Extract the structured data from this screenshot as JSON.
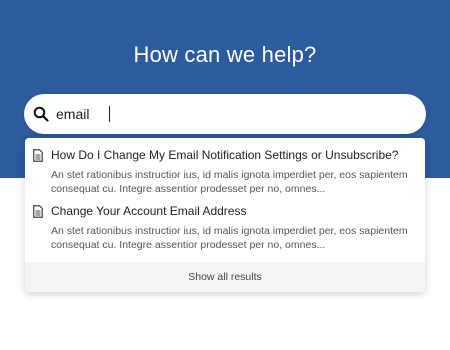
{
  "hero": {
    "title": "How can we help?"
  },
  "search": {
    "value": "email",
    "placeholder": ""
  },
  "results": [
    {
      "title": "How Do I Change My Email Notification Settings or Unsubscribe?",
      "snippet": "An stet rationibus instructior ius, id malis ignota imperdiet per, eos sapientem consequat cu. Integre assentior prodesset per no, omnes..."
    },
    {
      "title": "Change Your Account Email Address",
      "snippet": "An stet rationibus instructior ius, id malis ignota imperdiet per, eos sapientem consequat cu. Integre assentior prodesset per no, omnes..."
    }
  ],
  "footer": {
    "show_all_label": "Show all results"
  },
  "colors": {
    "hero_bg": "#2c5b9e",
    "panel_footer_bg": "#f5f5f5"
  },
  "icons": {
    "search": "search-icon",
    "document": "document-icon"
  }
}
